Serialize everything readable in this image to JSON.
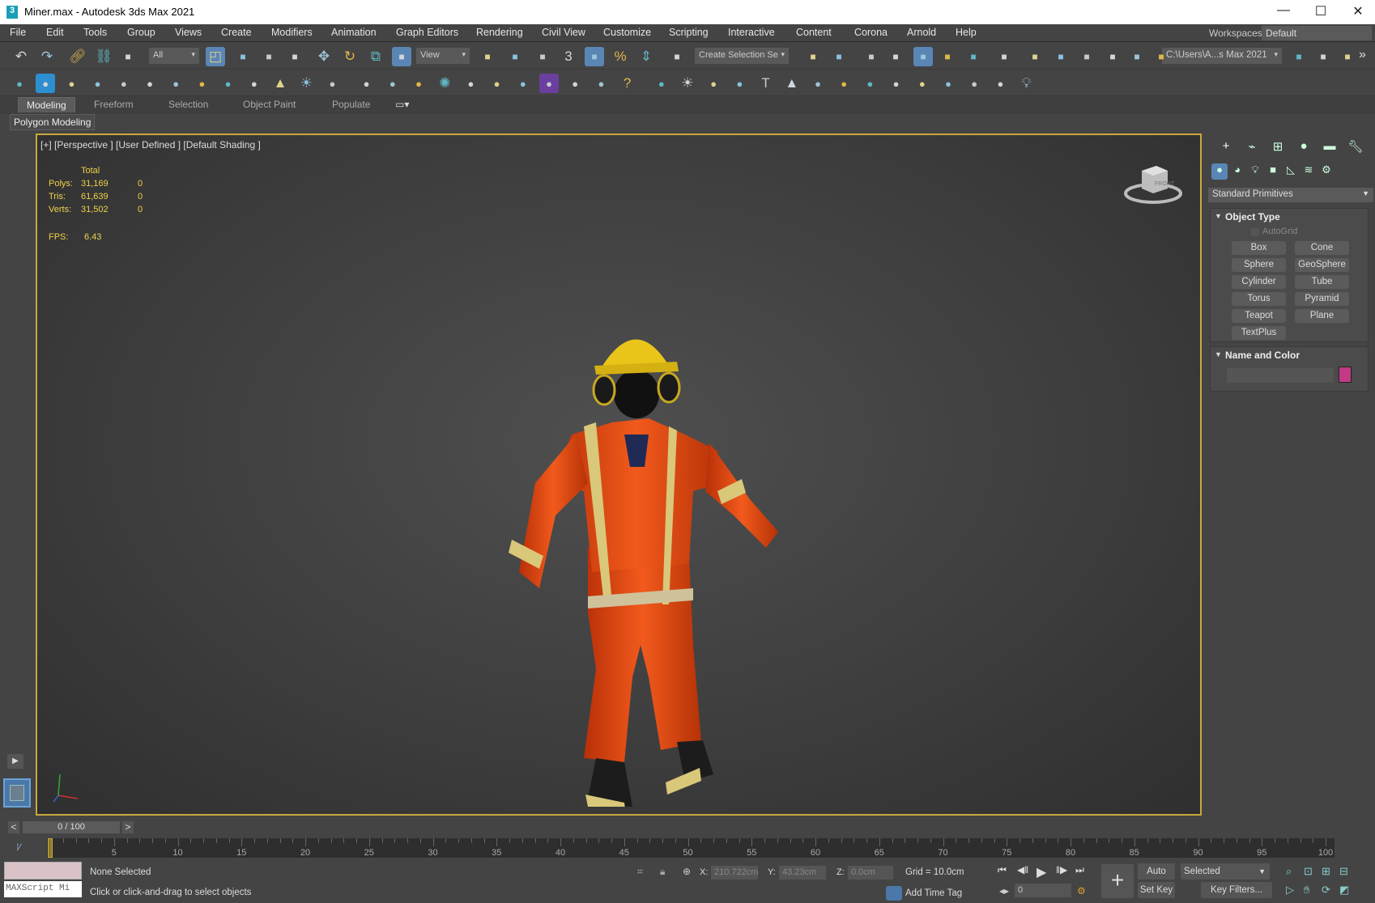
{
  "window": {
    "title": "Miner.max - Autodesk 3ds Max 2021",
    "app_icon": "3",
    "minimize": "—",
    "maximize": "☐",
    "close": "✕"
  },
  "menu": [
    "File",
    "Edit",
    "Tools",
    "Group",
    "Views",
    "Create",
    "Modifiers",
    "Animation",
    "Graph Editors",
    "Rendering",
    "Civil View",
    "Customize",
    "Scripting",
    "Interactive",
    "Content",
    "Corona",
    "Arnold",
    "Help"
  ],
  "workspaces": {
    "label": "Workspaces:",
    "value": "Default"
  },
  "toolbar1": {
    "selection_filter": "All",
    "ref_coord": "View",
    "named_selection": "Create Selection Se",
    "project_path": "C:\\Users\\A...s Max 2021",
    "more": "»",
    "icons": [
      "undo-icon",
      "redo-icon",
      "link-icon",
      "unlink-icon",
      "bind-spacewarp-icon",
      "select-object-icon",
      "select-by-name-icon",
      "rect-selection-icon",
      "window-crossing-icon",
      "move-icon",
      "rotate-icon",
      "scale-icon",
      "placement-icon",
      "mirror-icon",
      "pivot-center-icon",
      "manipulate-icon",
      "snaps-toggle-icon",
      "angle-snap-icon",
      "percent-snap-icon",
      "spinner-snap-icon",
      "edit-named-selection-icon",
      "mirror-tool-icon",
      "align-icon",
      "scene-explorer-icon",
      "layer-explorer-icon",
      "ribbon-toggle-icon",
      "curve-editor-icon",
      "schematic-view-icon",
      "material-editor-icon",
      "render-setup-icon",
      "rendered-frame-window-icon",
      "render-production-icon",
      "render-cloud-icon",
      "render-iterative-icon",
      "render-grid-icon",
      "set-project-icon",
      "open-project-icon",
      "project-folder-icon"
    ]
  },
  "toolbar2": {
    "icons": [
      "teapot-icon",
      "corona-logo-icon",
      "corona-vfb-icon",
      "corona-light-icon",
      "corona-camera-icon",
      "corona-proxy-icon",
      "plane-icon",
      "sphere-icon",
      "dome-icon",
      "bowl-icon",
      "cone-icon",
      "sun-icon",
      "sky-icon",
      "scatter-icon",
      "atoms-icon",
      "lidar-icon",
      "gear-icon",
      "grass-icon",
      "material-sphere-icon",
      "multimap-icon",
      "palette-icon",
      "shadow-catcher-icon",
      "converter-icon",
      "help-icon",
      "arnold-light-icon",
      "sun-light-icon",
      "camera-icon",
      "tree-icon",
      "text-icon",
      "pyramid-icon",
      "lamp-icon",
      "ring-icon",
      "render-icon",
      "bounding-icon",
      "frame-icon",
      "camera-rig-icon",
      "window-icon",
      "teapot-outline-icon",
      "bulb-icon"
    ]
  },
  "ribbon": {
    "tabs": [
      "Modeling",
      "Freeform",
      "Selection",
      "Object Paint",
      "Populate"
    ],
    "active": "Modeling",
    "sub": "Polygon Modeling"
  },
  "viewport": {
    "label": "[+] [Perspective ] [User Defined ] [Default Shading ]",
    "stats": {
      "header": "Total",
      "rows": [
        {
          "label": "Polys:",
          "total": "31,169",
          "sel": "0"
        },
        {
          "label": "Tris:",
          "total": "61,639",
          "sel": "0"
        },
        {
          "label": "Verts:",
          "total": "31,502",
          "sel": "0"
        }
      ],
      "fps_label": "FPS:",
      "fps": "6.43"
    },
    "viewcube": "FRONT",
    "axis": {
      "x": "x",
      "y": "y",
      "z": "z"
    }
  },
  "command_panel": {
    "tabs": [
      "create-tab",
      "modify-tab",
      "hierarchy-tab",
      "motion-tab",
      "display-tab",
      "utilities-tab"
    ],
    "categories": [
      "geometry-icon",
      "shapes-icon",
      "lights-icon",
      "cameras-icon",
      "helpers-icon",
      "space-warps-icon",
      "systems-icon"
    ],
    "type_dropdown": "Standard Primitives",
    "object_type": {
      "title": "Object Type",
      "autogrid": "AutoGrid",
      "buttons": [
        "Box",
        "Cone",
        "Sphere",
        "GeoSphere",
        "Cylinder",
        "Tube",
        "Torus",
        "Pyramid",
        "Teapot",
        "Plane",
        "TextPlus"
      ]
    },
    "name_color": {
      "title": "Name and Color",
      "name_value": "",
      "color": "#c23a86"
    }
  },
  "timeline": {
    "slider": "0 / 100",
    "prev": "<",
    "next": ">",
    "current": 0,
    "start": 0,
    "end": 100,
    "labels": [
      "0",
      "5",
      "10",
      "15",
      "20",
      "25",
      "30",
      "35",
      "40",
      "45",
      "50",
      "55",
      "60",
      "65",
      "70",
      "75",
      "80",
      "85",
      "90",
      "95",
      "100"
    ]
  },
  "status": {
    "maxscript": "MAXScript Mi",
    "selection": "None Selected",
    "prompt": "Click or click-and-drag to select objects",
    "x_label": "X:",
    "x": "210.722cm",
    "y_label": "Y:",
    "y": "43.23cm",
    "z_label": "Z:",
    "z": "0.0cm",
    "grid": "Grid = 10.0cm",
    "time_tag": "Add Time Tag",
    "auto_key": "Auto Key",
    "set_key": "Set Key",
    "key_mode": "Selected",
    "key_filters": "Key Filters...",
    "frame": "0"
  }
}
